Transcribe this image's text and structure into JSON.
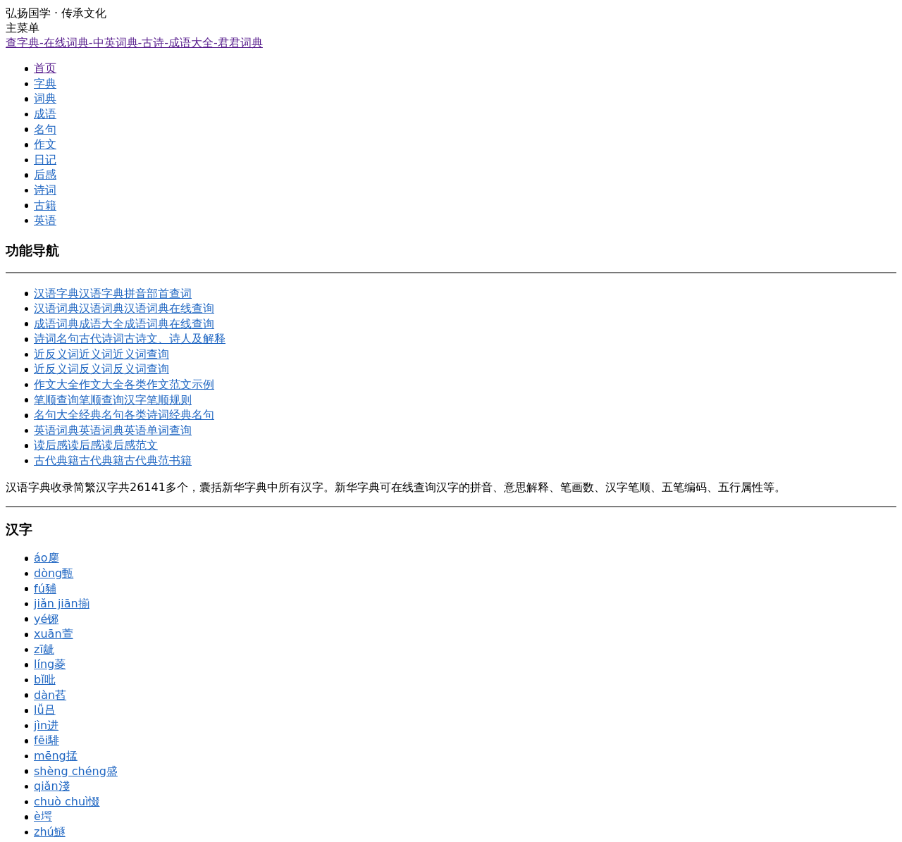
{
  "header": {
    "tagline": "弘扬国学 · 传承文化",
    "menu_label": "主菜单",
    "site_link": {
      "text": "查字典-在线词典-中英词典-古诗-成语大全-君君词典",
      "visited": true
    }
  },
  "main_menu": [
    {
      "label": "首页",
      "visited": true
    },
    {
      "label": "字典",
      "visited": false
    },
    {
      "label": "词典",
      "visited": false
    },
    {
      "label": "成语",
      "visited": false
    },
    {
      "label": "名句",
      "visited": false
    },
    {
      "label": "作文",
      "visited": false
    },
    {
      "label": "日记",
      "visited": false
    },
    {
      "label": "后感",
      "visited": false
    },
    {
      "label": "诗词",
      "visited": false
    },
    {
      "label": "古籍",
      "visited": false
    },
    {
      "label": "英语",
      "visited": false
    }
  ],
  "feature_nav": {
    "heading": "功能导航",
    "links": [
      "汉语字典汉语字典拼音部首查词",
      "汉语词典汉语词典汉语词典在线查询",
      "成语词典成语大全成语词典在线查询",
      "诗词名句古代诗词古诗文、诗人及解释",
      "近反义词近义词近义词查询",
      "近反义词反义词反义词查询",
      "作文大全作文大全各类作文范文示例",
      "笔顺查询笔顺查询汉字笔顺规则",
      "名句大全经典名句各类诗词经典名句",
      "英语词典英语词典英语单词查询",
      "读后感读后感读后感范文",
      "古代典籍古代典籍古代典范书籍"
    ]
  },
  "intro": "汉语字典收录简繁汉字共26141多个，囊括新华字典中所有汉字。新华字典可在线查询汉字的拼音、意思解释、笔画数、汉字笔顺、五笔编码、五行属性等。",
  "hanzi": {
    "heading": "汉字",
    "entries": [
      "áo鏖",
      "dòng甄",
      "fú豧",
      "jiǎn jiān揃",
      "yé铘",
      "xuān萱",
      "zī龇",
      "líng菱",
      "bǐ吡",
      "dàn萏",
      "lǚ吕",
      "jìn进",
      "fēi騑",
      "mēng掹",
      "shèng chéng盛",
      "qiǎn淺",
      "chuò chuì惙",
      "è堮",
      "zhú鱁"
    ]
  }
}
